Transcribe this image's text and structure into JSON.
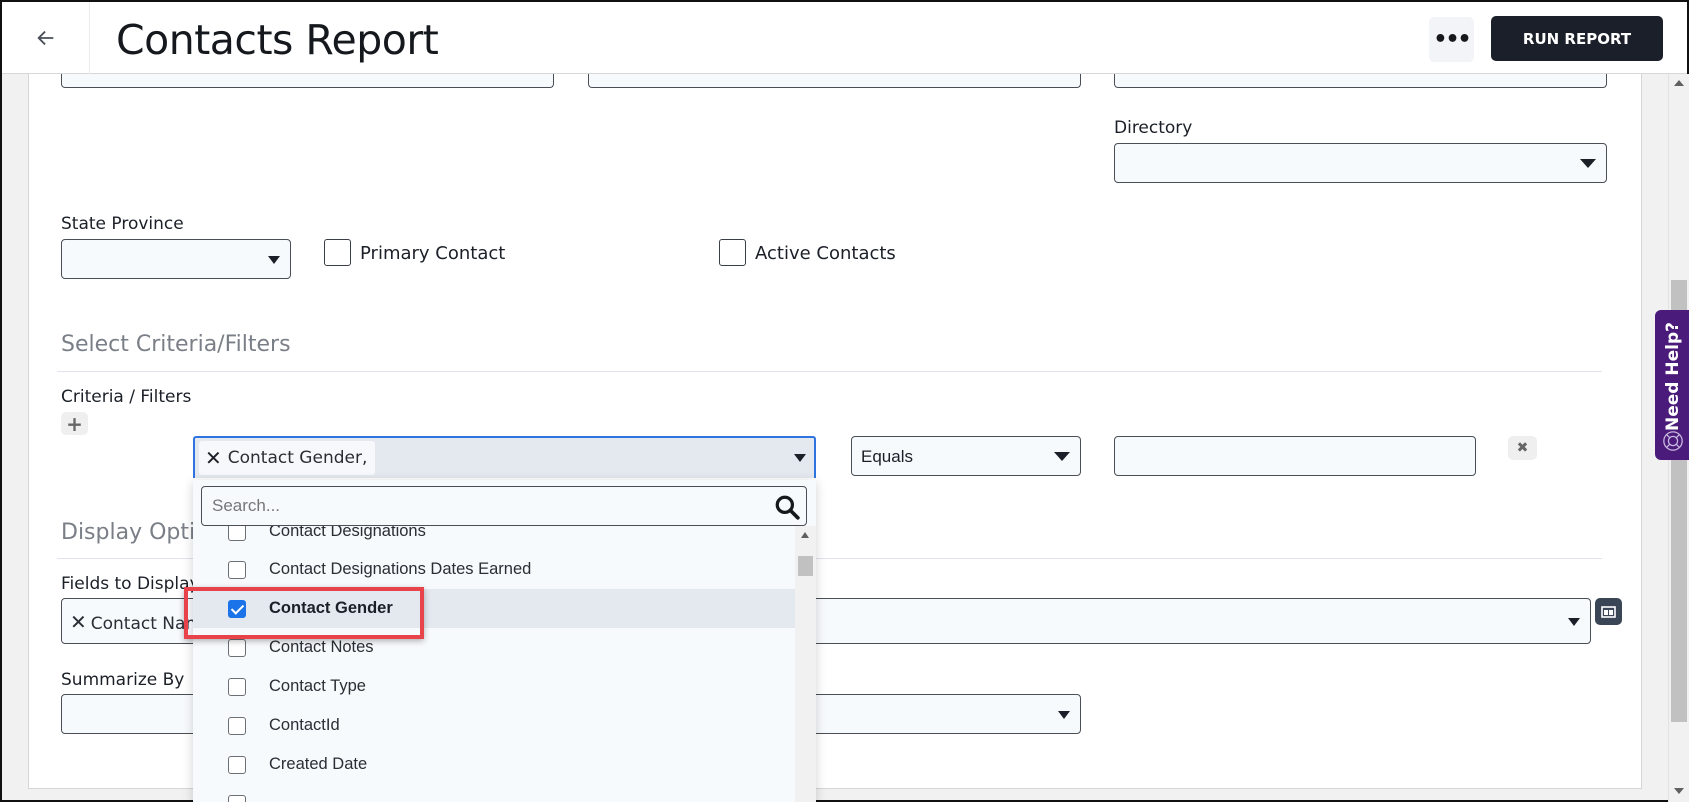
{
  "header": {
    "back_icon": "arrow-left-icon",
    "title": "Contacts Report",
    "more_label": "•••",
    "run_report_label": "RUN REPORT"
  },
  "filters": {
    "directory_label": "Directory",
    "directory_value": "",
    "state_province_label": "State Province",
    "state_province_value": "",
    "primary_contact_label": "Primary Contact",
    "primary_contact_checked": false,
    "active_contacts_label": "Active Contacts",
    "active_contacts_checked": false
  },
  "criteria_section": {
    "title": "Select Criteria/Filters",
    "criteria_label": "Criteria / Filters",
    "add_label": "+",
    "field_chip": "Contact Gender,",
    "operator_value": "Equals",
    "value_input": "",
    "remove_label": "✖"
  },
  "dropdown": {
    "search_placeholder": "Search...",
    "items": [
      {
        "label": "Contact Designations",
        "checked": false
      },
      {
        "label": "Contact Designations Dates Earned",
        "checked": false
      },
      {
        "label": "Contact Gender",
        "checked": true
      },
      {
        "label": "Contact Notes",
        "checked": false
      },
      {
        "label": "Contact Type",
        "checked": false
      },
      {
        "label": "ContactId",
        "checked": false
      },
      {
        "label": "Created Date",
        "checked": false
      },
      {
        "label": "",
        "checked": false
      }
    ]
  },
  "display_section": {
    "title": "Display Options",
    "fields_label": "Fields to Display",
    "fields_chip": "Contact Name",
    "summarize_label": "Summarize By",
    "summarize_value": ""
  },
  "need_help": {
    "label": "Need Help?",
    "brand_color": "#4a1b7a"
  },
  "colors": {
    "accent": "#2f73e0",
    "checkbox_checked": "#1a73e8",
    "highlight": "#e8424a",
    "primary_button": "#1a1f29"
  }
}
